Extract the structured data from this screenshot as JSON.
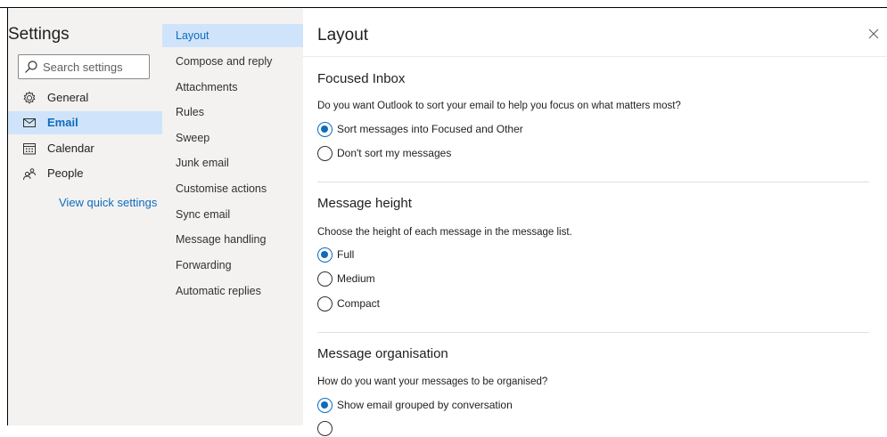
{
  "settings_nav": {
    "title": "Settings",
    "search_placeholder": "Search settings",
    "items": [
      {
        "label": "General",
        "icon": "gear-icon"
      },
      {
        "label": "Email",
        "icon": "mail-icon",
        "selected": true
      },
      {
        "label": "Calendar",
        "icon": "calendar-icon"
      },
      {
        "label": "People",
        "icon": "people-icon"
      }
    ],
    "quick_settings_link": "View quick settings"
  },
  "email_subnav": {
    "items": [
      {
        "label": "Layout",
        "selected": true
      },
      {
        "label": "Compose and reply"
      },
      {
        "label": "Attachments"
      },
      {
        "label": "Rules"
      },
      {
        "label": "Sweep"
      },
      {
        "label": "Junk email"
      },
      {
        "label": "Customise actions"
      },
      {
        "label": "Sync email"
      },
      {
        "label": "Message handling"
      },
      {
        "label": "Forwarding"
      },
      {
        "label": "Automatic replies"
      }
    ]
  },
  "main": {
    "title": "Layout",
    "sections": [
      {
        "title": "Focused Inbox",
        "question": "Do you want Outlook to sort your email to help you focus on what matters most?",
        "options": [
          {
            "label": "Sort messages into Focused and Other",
            "checked": true
          },
          {
            "label": "Don't sort my messages",
            "checked": false
          }
        ]
      },
      {
        "title": "Message height",
        "question": "Choose the height of each message in the message list.",
        "options": [
          {
            "label": "Full",
            "checked": true
          },
          {
            "label": "Medium",
            "checked": false
          },
          {
            "label": "Compact",
            "checked": false
          }
        ]
      },
      {
        "title": "Message organisation",
        "question": "How do you want your messages to be organised?",
        "options": [
          {
            "label": "Show email grouped by conversation",
            "checked": true
          }
        ]
      }
    ]
  },
  "colors": {
    "accent": "#0f6cbd",
    "selected_bg": "#cfe4fa",
    "pane_bg": "#f3f2f1"
  }
}
